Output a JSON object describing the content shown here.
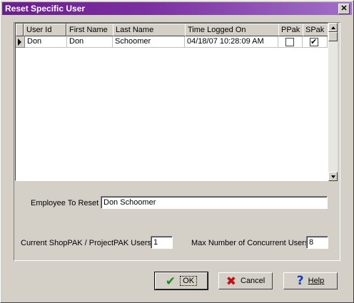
{
  "window": {
    "title": "Reset Specific User",
    "close_label": "✕"
  },
  "grid": {
    "columns": [
      "User Id",
      "First Name",
      "Last Name",
      "Time Logged On",
      "PPak",
      "SPak"
    ],
    "rows": [
      {
        "user_id": "Don",
        "first_name": "Don",
        "last_name": "Schoomer",
        "time_logged_on": "04/18/07 10:28:09 AM",
        "ppak": false,
        "spak": true
      }
    ]
  },
  "form": {
    "employee_label": "Employee To Reset",
    "employee_value": "Don Schoomer",
    "current_users_label": "Current ShopPAK / ProjectPAK Users",
    "current_users_value": "1",
    "max_users_label": "Max Number of Concurrent Users",
    "max_users_value": "8"
  },
  "buttons": {
    "ok": "OK",
    "cancel": "Cancel",
    "help": "Help"
  },
  "colors": {
    "ok_icon": "#1a8c1a",
    "cancel_icon": "#c01010",
    "help_icon": "#1040c0"
  }
}
